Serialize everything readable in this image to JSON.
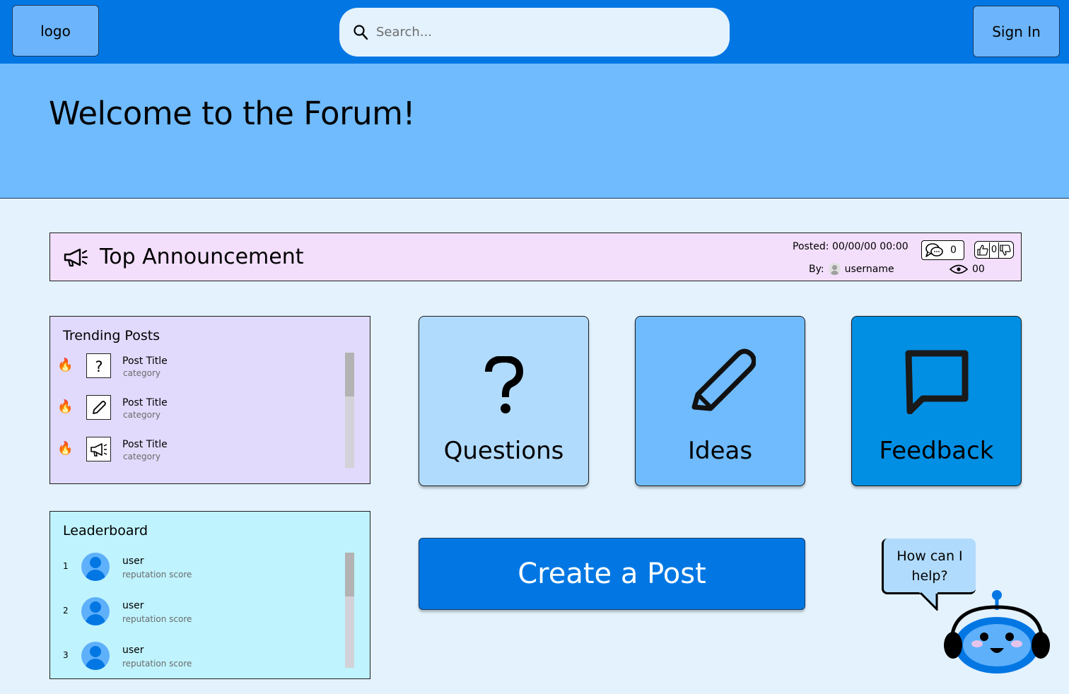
{
  "header": {
    "logo_label": "logo",
    "search_placeholder": "Search...",
    "signin_label": "Sign In"
  },
  "hero": {
    "title": "Welcome to the Forum!"
  },
  "announcement": {
    "title": "Top Announcement",
    "posted": "Posted: 00/00/00 00:00",
    "by_label": "By:",
    "username": "username",
    "comments": "0",
    "votes": "0",
    "views": "00"
  },
  "trending": {
    "title": "Trending Posts",
    "items": [
      {
        "title": "Post Title",
        "category": "category",
        "icon": "question-icon"
      },
      {
        "title": "Post Title",
        "category": "category",
        "icon": "pencil-icon"
      },
      {
        "title": "Post Title",
        "category": "category",
        "icon": "megaphone-icon"
      }
    ]
  },
  "leaderboard": {
    "title": "Leaderboard",
    "items": [
      {
        "rank": "1",
        "user": "user",
        "score": "reputation score"
      },
      {
        "rank": "2",
        "user": "user",
        "score": "reputation score"
      },
      {
        "rank": "3",
        "user": "user",
        "score": "reputation score"
      }
    ]
  },
  "categories": {
    "questions": "Questions",
    "ideas": "Ideas",
    "feedback": "Feedback"
  },
  "create_post_label": "Create a Post",
  "helper": {
    "bubble_line1": "How can I",
    "bubble_line2": "help?"
  },
  "colors": {
    "topbar": "#0277e3",
    "hero": "#6fbbfd",
    "page_bg": "#e3f2fd",
    "announcement_bg": "#f3dffc",
    "trending_bg": "#e1dafc",
    "leaderboard_bg": "#bff3fe"
  }
}
